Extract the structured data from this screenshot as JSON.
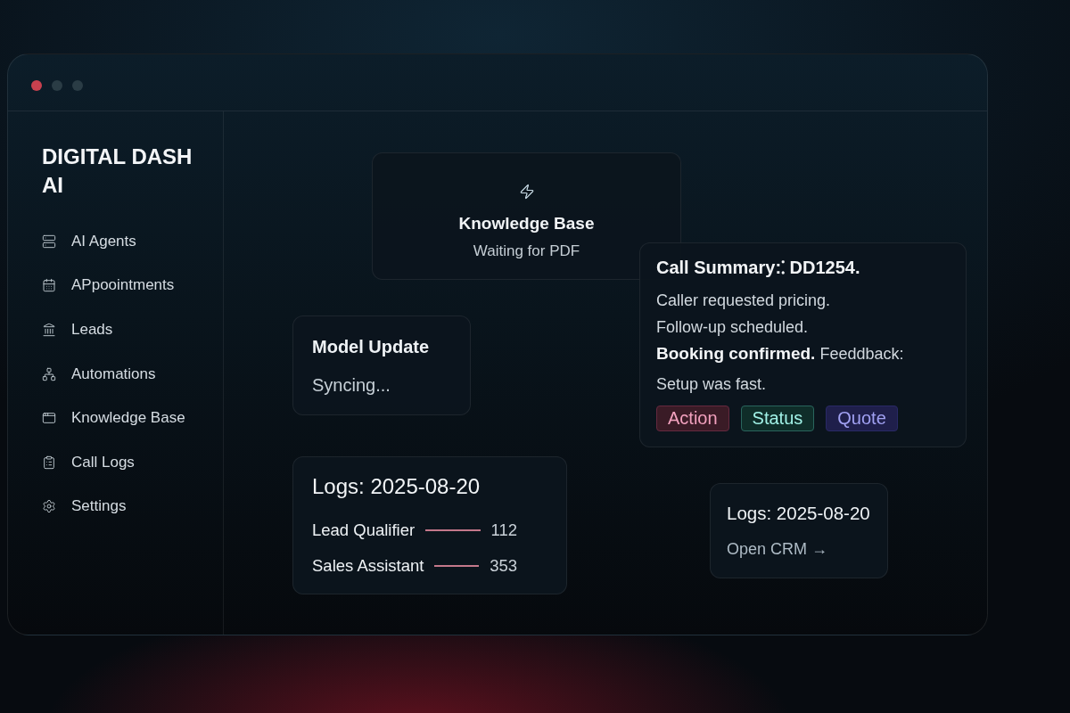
{
  "window": {
    "controls": [
      {
        "color": "#c8414f"
      },
      {
        "color": "#2a3c45"
      },
      {
        "color": "#2a3c45"
      }
    ]
  },
  "sidebar": {
    "brand": "DIGITAL DASH AI",
    "items": [
      {
        "label": "AI Agents"
      },
      {
        "label": "APpoointments"
      },
      {
        "label": "Leads"
      },
      {
        "label": "Automations"
      },
      {
        "label": "Knowledge Base"
      },
      {
        "label": "Call Logs"
      },
      {
        "label": "Settings"
      }
    ]
  },
  "main": {
    "knowledge_base": {
      "title": "Knowledge Base",
      "status": "Waiting for PDF"
    },
    "call_summary": {
      "title": "Call Summary:⁚ DD1254.",
      "lines": [
        "Caller requested pricing.",
        "Follow-up scheduled.",
        "**Booking confirmed.** Feeddback:",
        "Setup was fast."
      ],
      "tags": [
        {
          "label": "Action",
          "color": "#3a1b26"
        },
        {
          "label": "Status",
          "color": "#0f2d29"
        },
        {
          "label": "Quote",
          "color": "#1f1f4b"
        }
      ]
    },
    "model_update": {
      "title": "Model Update",
      "status": "Syncing..."
    },
    "logs": {
      "title": "Logs: 2025-08-20",
      "rows": [
        {
          "name": "Lead Qualifier",
          "value": "112"
        },
        {
          "name": "Sales Assistant",
          "value": "353"
        }
      ]
    },
    "crm": {
      "title": "Logs: 2025-08-20",
      "link": "Open CRM →"
    }
  }
}
